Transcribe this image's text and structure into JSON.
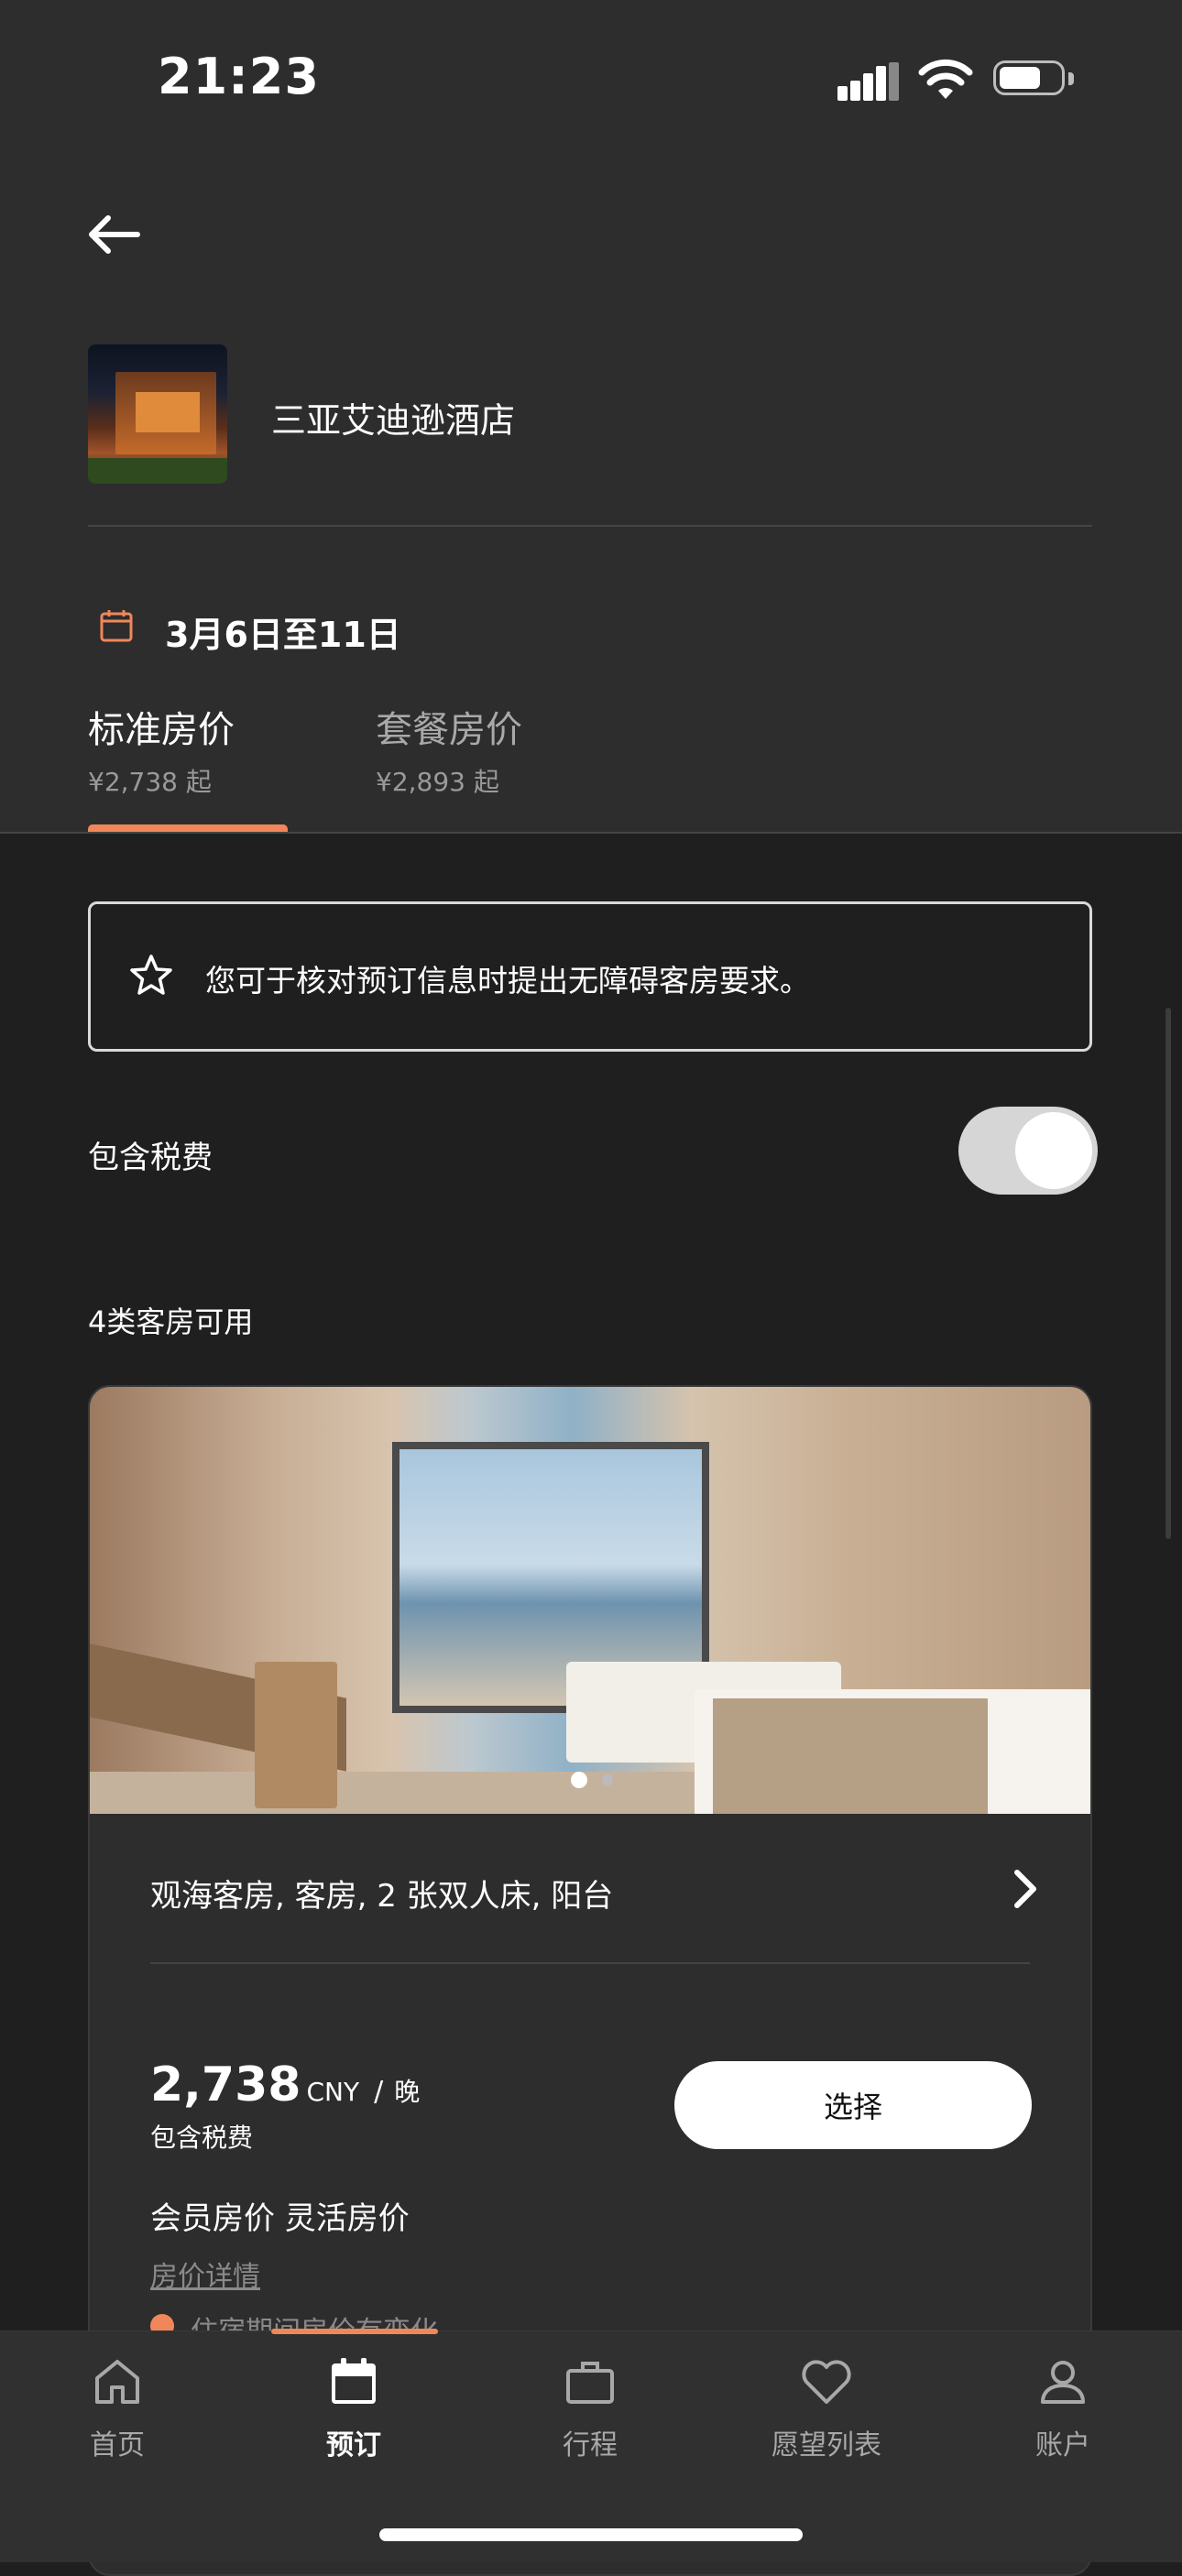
{
  "status_bar": {
    "time": "21:23"
  },
  "hotel": {
    "name": "三亚艾迪逊酒店"
  },
  "stay": {
    "dates": "3月6日至11日"
  },
  "rate_tabs": [
    {
      "label": "标准房价",
      "price": "¥2,738 起",
      "selected": true
    },
    {
      "label": "套餐房价",
      "price": "¥2,893 起",
      "selected": false
    }
  ],
  "notice": {
    "text": "您可于核对预订信息时提出无障碍客房要求。"
  },
  "tax_toggle": {
    "label": "包含税费",
    "on": true
  },
  "rooms_available": "4类客房可用",
  "room_card": {
    "name": "观海客房, 客房, 2 张双人床, 阳台",
    "price": "2,738",
    "currency": "CNY",
    "slash": "/",
    "per": "晚",
    "price_note": "包含税费",
    "select_label": "选择",
    "rate_types": "会员房价 灵活房价",
    "rate_details": "房价详情",
    "rate_change": "住宿期间房价有变化",
    "photo_count": 2,
    "photo_index": 1
  },
  "bottom_nav": [
    {
      "label": "首页",
      "icon": "home-icon",
      "active": false
    },
    {
      "label": "预订",
      "icon": "calendar-icon",
      "active": true
    },
    {
      "label": "行程",
      "icon": "briefcase-icon",
      "active": false
    },
    {
      "label": "愿望列表",
      "icon": "heart-icon",
      "active": false
    },
    {
      "label": "账户",
      "icon": "user-icon",
      "active": false
    }
  ],
  "colors": {
    "accent": "#f0875a",
    "header_bg": "#2d2d2d",
    "body_bg": "#1f1f1f"
  }
}
